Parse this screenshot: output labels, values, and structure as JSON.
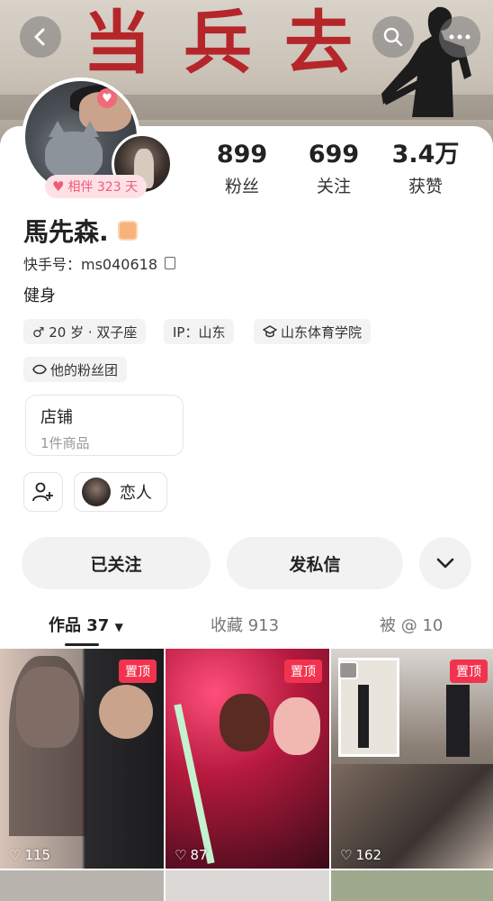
{
  "banner": {
    "text": "当兵去"
  },
  "stats": [
    {
      "value": "899",
      "label": "粉丝"
    },
    {
      "value": "699",
      "label": "关注"
    },
    {
      "value": "3.4万",
      "label": "获赞"
    }
  ],
  "companion": {
    "text": "相伴 323 天"
  },
  "profile": {
    "name": "馬先森.",
    "kuaishou_id": "快手号：ms040618",
    "bio": "健身",
    "tags": [
      "♂ 20 岁 · 双子座",
      "IP：山东",
      "山东体育学院"
    ],
    "fan_group": "他的粉丝团"
  },
  "shop": {
    "title": "店铺",
    "subtitle": "1件商品"
  },
  "lover": {
    "label": "恋人"
  },
  "actions": {
    "followed": "已关注",
    "message": "发私信"
  },
  "tabs": [
    "作品 37",
    "收藏 913",
    "被 @ 10"
  ],
  "posts": [
    {
      "pinned": "置顶",
      "likes": "115"
    },
    {
      "pinned": "置顶",
      "likes": "87"
    },
    {
      "pinned": "置顶",
      "likes": "162"
    }
  ],
  "colors": {
    "accent": "#f2334f",
    "companion": "#f15a76",
    "banner_text": "#b5262a"
  }
}
